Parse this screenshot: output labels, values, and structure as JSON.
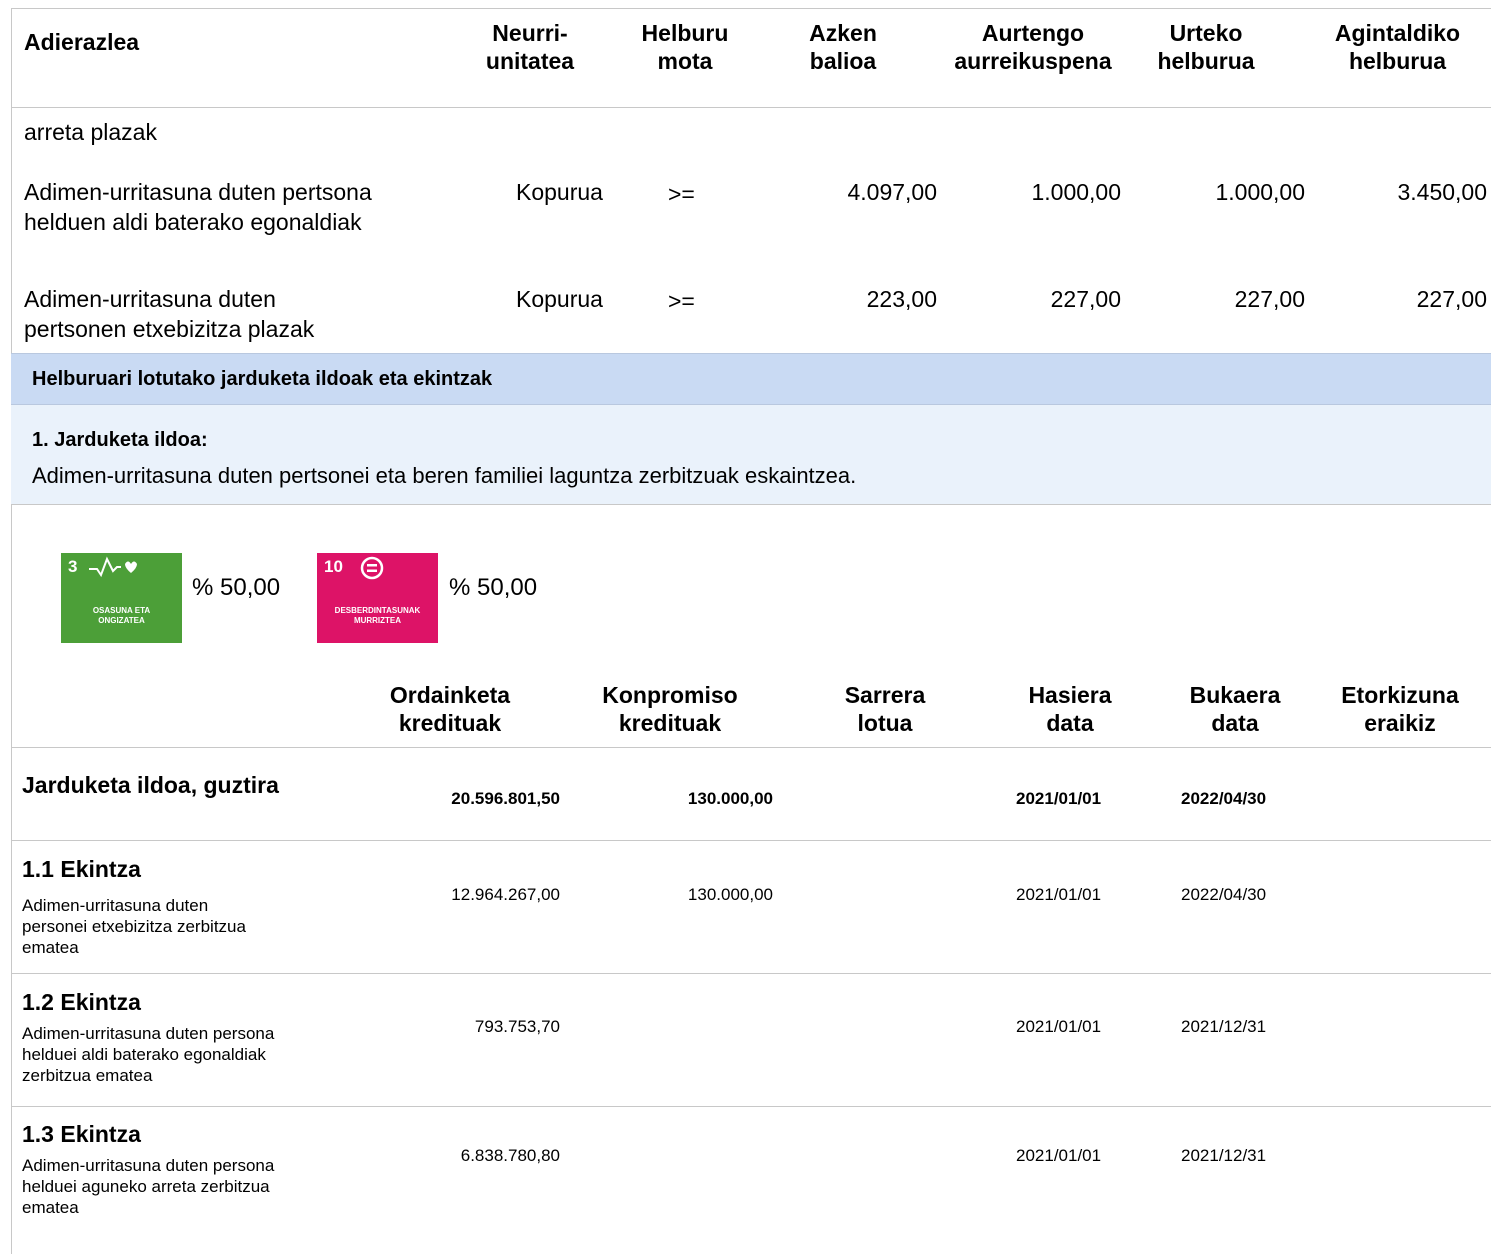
{
  "indicators_header": {
    "adierazlea": "Adierazlea",
    "neurri_1": "Neurri-",
    "neurri_2": "unitatea",
    "helburu_1": "Helburu",
    "helburu_2": "mota",
    "azken_1": "Azken",
    "azken_2": "balioa",
    "aurtengo_1": "Aurtengo",
    "aurtengo_2": "aurreikuspena",
    "urteko_1": "Urteko",
    "urteko_2": "helburua",
    "agintaldiko_1": "Agintaldiko",
    "agintaldiko_2": "helburua"
  },
  "continuation_text": "arreta plazak",
  "indicators": [
    {
      "name_1": "Adimen-urritasuna duten pertsona",
      "name_2": "helduen aldi baterako egonaldiak",
      "unit": "Kopurua",
      "type": ">=",
      "last_value": "4.097,00",
      "forecast": "1.000,00",
      "annual_target": "1.000,00",
      "term_target": "3.450,00"
    },
    {
      "name_1": "Adimen-urritasuna duten",
      "name_2": "pertsonen etxebizitza plazak",
      "unit": "Kopurua",
      "type": ">=",
      "last_value": "223,00",
      "forecast": "227,00",
      "annual_target": "227,00",
      "term_target": "227,00"
    }
  ],
  "section_title": "Helburuari lotutako jarduketa ildoak eta ekintzak",
  "line": {
    "title": "1. Jarduketa ildoa:",
    "description": "Adimen-urritasuna duten pertsonei eta beren familiei laguntza zerbitzuak eskaintzea."
  },
  "sdgs": [
    {
      "number": "3",
      "caption_1": "OSASUNA ETA",
      "caption_2": "ONGIZATEA",
      "percent": "% 50,00",
      "color": "#4c9f38"
    },
    {
      "number": "10",
      "caption_1": "DESBERDINTASUNAK",
      "caption_2": "MURRIZTEA",
      "percent": "% 50,00",
      "color": "#dd1367"
    }
  ],
  "actions_header": {
    "ordainketa_1": "Ordainketa",
    "ordainketa_2": "kredituak",
    "konpromiso_1": "Konpromiso",
    "konpromiso_2": "kredituak",
    "sarrera_1": "Sarrera",
    "sarrera_2": "lotua",
    "hasiera_1": "Hasiera",
    "hasiera_2": "data",
    "bukaera_1": "Bukaera",
    "bukaera_2": "data",
    "etorkizuna_1": "Etorkizuna",
    "etorkizuna_2": "eraikiz"
  },
  "total": {
    "label": "Jarduketa ildoa, guztira",
    "ordainketa": "20.596.801,50",
    "konpromiso": "130.000,00",
    "hasiera": "2021/01/01",
    "bukaera": "2022/04/30"
  },
  "actions": [
    {
      "title": "1.1 Ekintza",
      "desc_1": "Adimen-urritasuna duten",
      "desc_2": "personei etxebizitza zerbitzua",
      "desc_3": "ematea",
      "ordainketa": "12.964.267,00",
      "konpromiso": "130.000,00",
      "hasiera": "2021/01/01",
      "bukaera": "2022/04/30"
    },
    {
      "title": "1.2 Ekintza",
      "desc_1": "Adimen-urritasuna duten persona",
      "desc_2": "helduei aldi baterako egonaldiak",
      "desc_3": "zerbitzua ematea",
      "ordainketa": "793.753,70",
      "konpromiso": "",
      "hasiera": "2021/01/01",
      "bukaera": "2021/12/31"
    },
    {
      "title": "1.3 Ekintza",
      "desc_1": "Adimen-urritasuna duten persona",
      "desc_2": "helduei aguneko arreta zerbitzua",
      "desc_3": "ematea",
      "ordainketa": "6.838.780,80",
      "konpromiso": "",
      "hasiera": "2021/01/01",
      "bukaera": "2021/12/31"
    }
  ]
}
